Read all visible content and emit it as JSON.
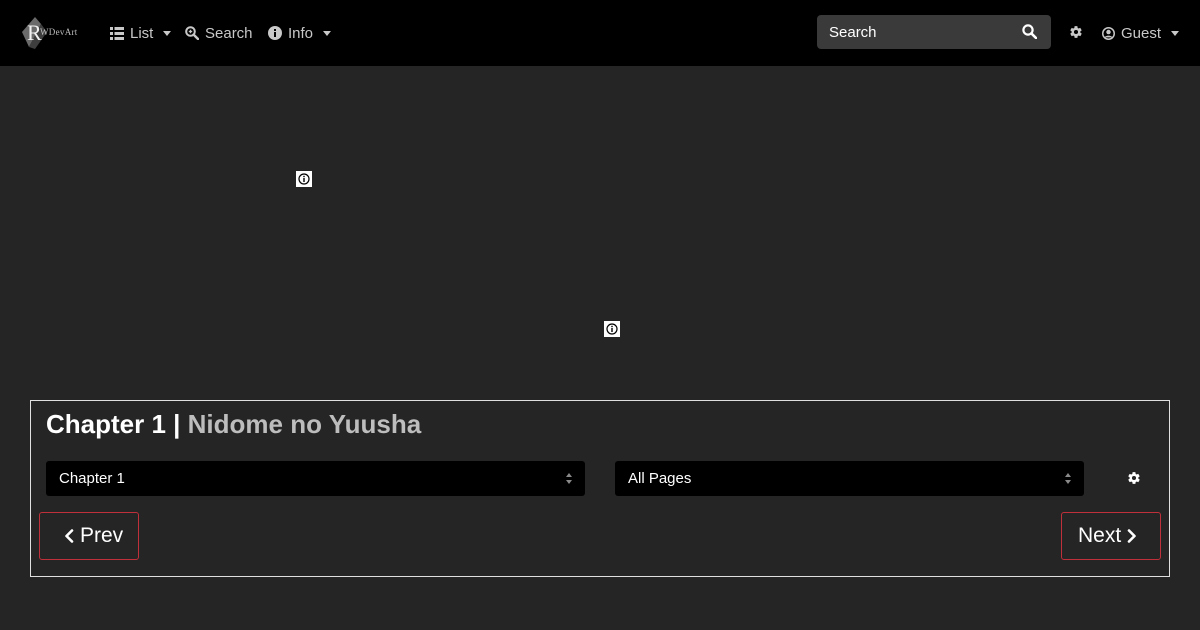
{
  "navbar": {
    "logo_text": "WDevArt",
    "menu": [
      {
        "label": "List",
        "icon": "list-icon"
      },
      {
        "label": "Search",
        "icon": "search-zoom-icon"
      },
      {
        "label": "Info",
        "icon": "info-icon"
      }
    ],
    "search": {
      "placeholder": "Search",
      "value": ""
    },
    "user": {
      "label": "Guest"
    }
  },
  "reader": {
    "chapter_label": "Chapter 1 |",
    "series_title": "Nidome no Yuusha",
    "chapter_select": {
      "selected": "Chapter 1"
    },
    "page_select": {
      "selected": "All Pages"
    },
    "prev_label": "Prev",
    "next_label": "Next"
  },
  "colors": {
    "background": "#252525",
    "navbar": "#000000",
    "accent_border": "#c0303a",
    "panel_border": "#e0e0e0"
  }
}
